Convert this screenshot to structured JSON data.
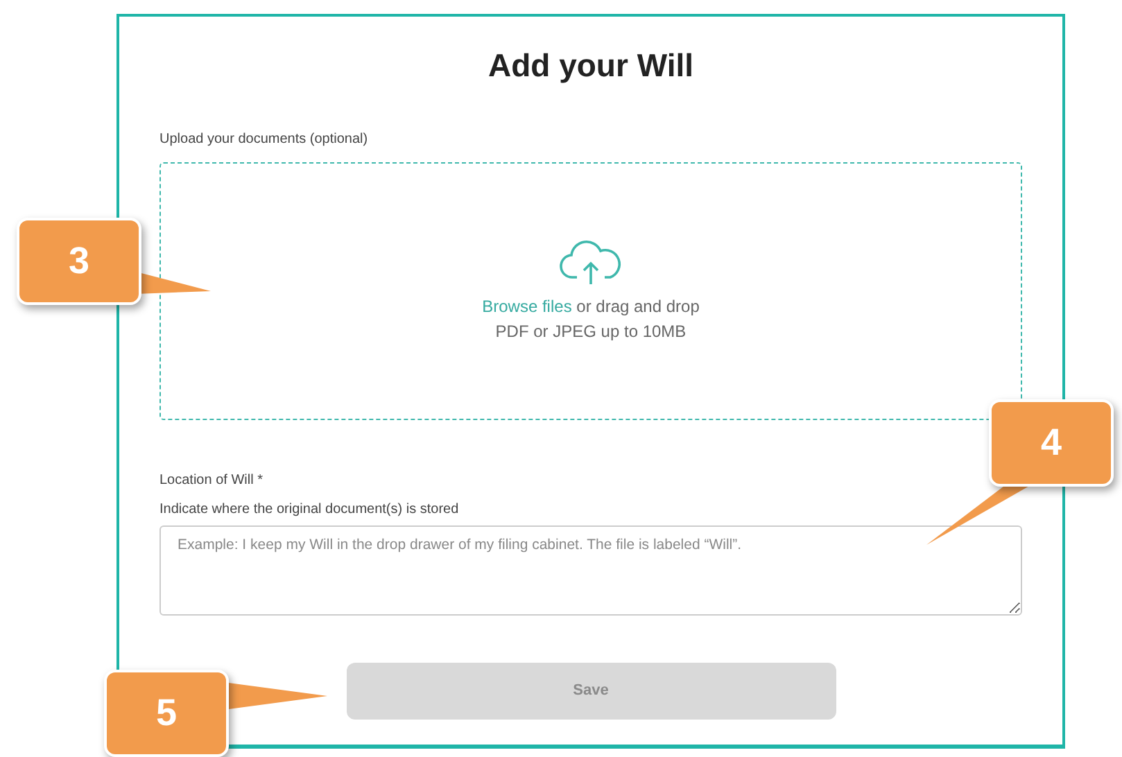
{
  "title": "Add your Will",
  "upload": {
    "label": "Upload your documents (optional)",
    "link": "Browse files",
    "text": "or drag and drop",
    "hint": "PDF or JPEG up to 10MB"
  },
  "location": {
    "label": "Location of Will *",
    "hint": "Indicate where the original document(s) is stored",
    "placeholder": "Example: I keep my Will in the drop drawer of my filing cabinet. The file is labeled “Will”."
  },
  "save_button": {
    "label": "Save",
    "disabled": true
  },
  "callouts": [
    {
      "number": "3"
    },
    {
      "number": "4"
    },
    {
      "number": "5"
    }
  ]
}
